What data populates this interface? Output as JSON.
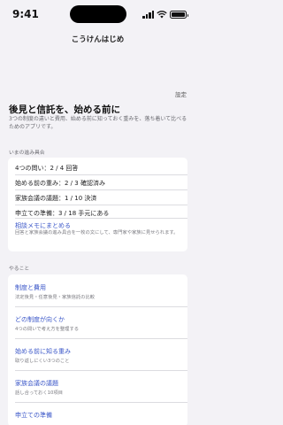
{
  "status": {
    "time": "9:41"
  },
  "header": {
    "title": "こうけんはじめ",
    "settings": "設定"
  },
  "hero": {
    "title": "後見と信託を、始める前に",
    "subtitle": "3つの制度の違いと費用、始める前に知っておく重みを、落ち着いて比べるためのアプリです。"
  },
  "progress": {
    "label": "いまの進み具合",
    "rows": [
      "4つの問い：2 / 4 回答",
      "始める前の重み：2 / 3 確認済み",
      "家族会議の議題：1 / 10 決済",
      "申立ての準備：3 / 18 手元にある"
    ],
    "memo_link": "相談メモにまとめる",
    "memo_note": "回答と家族会議の進み具合を一枚の文にして、専門家や家族に見せられます。"
  },
  "todo": {
    "label": "やること",
    "items": [
      {
        "title": "制度と費用",
        "sub": "法定後見・任意後見・家族信託の比較"
      },
      {
        "title": "どの制度が向くか",
        "sub": "4つの問いで考え方を整理する"
      },
      {
        "title": "始める前に知る重み",
        "sub": "取り返しにくい3つのこと"
      },
      {
        "title": "家族会議の議題",
        "sub": "話し合っておく10項目"
      },
      {
        "title": "申立ての準備",
        "sub": ""
      }
    ]
  }
}
